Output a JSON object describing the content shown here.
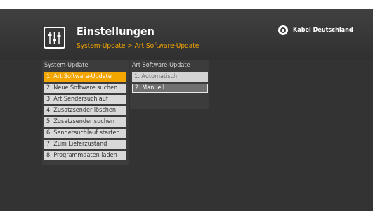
{
  "header": {
    "title": "Einstellungen",
    "breadcrumb": "System-Update > Art Software-Update",
    "icon": "settings-sliders-icon"
  },
  "brand": {
    "name": "Kabel Deutschland",
    "icon": "kabel-deutschland-logo-icon"
  },
  "colors": {
    "accent": "#f3a500",
    "background": "#333333",
    "menu_item": "#d9d9d9",
    "active_item": "#707070"
  },
  "left_panel": {
    "title": "System-Update",
    "selected_index": 0,
    "items": [
      {
        "label": "1. Art Software-Update"
      },
      {
        "label": "2. Neue Software suchen"
      },
      {
        "label": "3. Art Sendersuchlauf"
      },
      {
        "label": "4. Zusatzsender löschen"
      },
      {
        "label": "5. Zusatzsender suchen"
      },
      {
        "label": "6. Sendersuchlauf starten"
      },
      {
        "label": "7. Zum Lieferzustand"
      },
      {
        "label": "8. Programmdaten laden"
      }
    ]
  },
  "right_panel": {
    "title": "Art Software-Update",
    "selected_index": 1,
    "items": [
      {
        "label": "1. Automatisch"
      },
      {
        "label": "2. Manuell"
      }
    ]
  }
}
